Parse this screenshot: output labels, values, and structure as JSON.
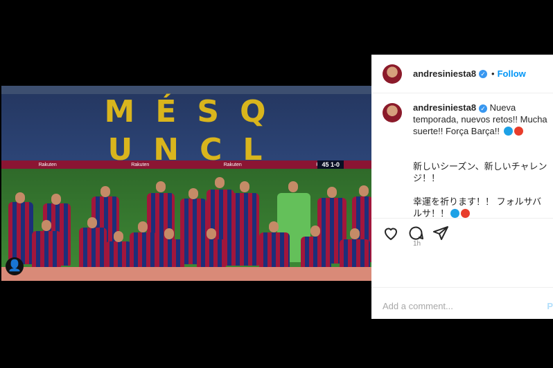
{
  "post": {
    "username": "andresiniesta8",
    "separator": "•",
    "follow_label": "Follow",
    "caption_es": "Nueva temporada, nuevos retos!! Mucha suerte!! Força Barça!!",
    "caption_jp_1": "新しいシーズン、新しいチャレンジ！！",
    "caption_jp_2": "幸運を祈ります！！ フォルサバルサ！！",
    "timestamp": "1h",
    "comment_placeholder": "Add a comment...",
    "post_label": "P"
  },
  "photo": {
    "stand_line_1": [
      "M",
      "É",
      "S",
      "Q"
    ],
    "stand_line_2": [
      "U",
      "N",
      "C",
      "L"
    ],
    "scoreboard": "45  1-0",
    "sponsor": "Rakuten"
  },
  "icons": {
    "verified": "verified-badge-icon",
    "like": "heart-icon",
    "comment": "comment-bubble-icon",
    "share": "paper-plane-icon",
    "user": "user-tag-icon"
  },
  "colors": {
    "blue_emoji": "#1da1e6",
    "red_emoji": "#e83d2b",
    "follow": "#0095f6"
  }
}
